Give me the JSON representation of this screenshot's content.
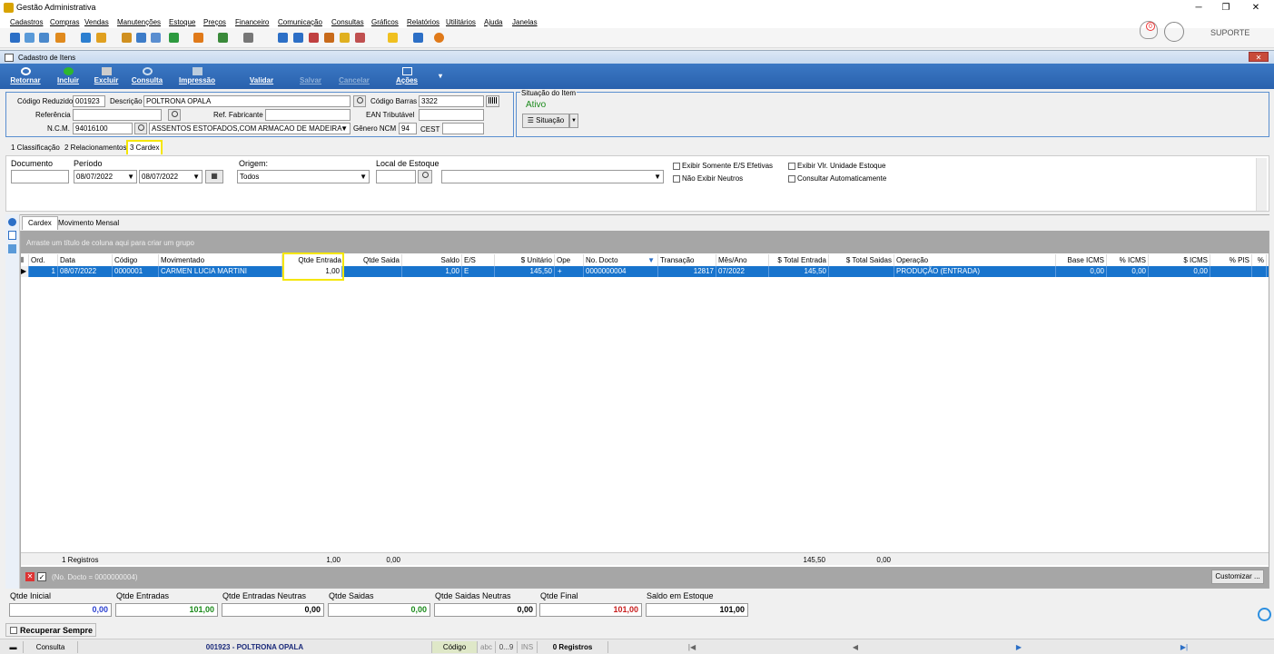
{
  "window": {
    "title": "Gestão Administrativa",
    "minimize": "─",
    "maximize": "❐",
    "close": "✕"
  },
  "menu": [
    "Cadastros",
    "Compras",
    "Vendas",
    "Manutenções",
    "Estoque",
    "Preços",
    "Financeiro",
    "Comunicação",
    "Consultas",
    "Gráficos",
    "Relatórios",
    "Utilitários",
    "Ajuda",
    "Janelas"
  ],
  "user": {
    "notifications": "0",
    "name": "SUPORTE"
  },
  "frame": {
    "title": "Cadastro de Itens",
    "close": "✕"
  },
  "ribbon": {
    "retornar": "Retornar",
    "incluir": "Incluir",
    "excluir": "Excluir",
    "consulta": "Consulta",
    "impressao": "Impressão",
    "validar": "Validar",
    "salvar": "Salvar",
    "cancelar": "Cancelar",
    "acoes": "Ações",
    "acoes_arrow": "▾"
  },
  "item": {
    "codigo_reduzido_label": "Código Reduzido",
    "codigo_reduzido": "001923",
    "descricao_label": "Descrição",
    "descricao": "POLTRONA OPALA",
    "codigo_barras_label": "Código Barras",
    "codigo_barras": "3322",
    "referencia_label": "Referência",
    "referencia": "",
    "ref_fabricante_label": "Ref. Fabricante",
    "ref_fabricante": "",
    "ean_label": "EAN Tributável",
    "ean": "",
    "ncm_label": "N.C.M.",
    "ncm": "94016100",
    "ncm_desc": "ASSENTOS ESTOFADOS,COM ARMACAO DE MADEIRA",
    "genero_label": "Gênero NCM",
    "genero": "94",
    "cest_label": "CEST",
    "cest": ""
  },
  "situacao": {
    "legend": "Situação do Item",
    "status": "Ativo",
    "button": "Situação"
  },
  "tabs": [
    "1 Classificação",
    "2 Relacionamentos",
    "3 Cardex"
  ],
  "filters": {
    "documento_label": "Documento",
    "documento": "",
    "periodo_label": "Período",
    "periodo_ini": "08/07/2022",
    "periodo_fim": "08/07/2022",
    "origem_label": "Origem:",
    "origem": "Todos",
    "local_label": "Local de Estoque",
    "local": "",
    "local_desc": "",
    "chk1": "Exibir Somente E/S Efetivas",
    "chk2": "Não Exibir Neutros",
    "chk3": "Exibir Vlr. Unidade Estoque",
    "chk4": "Consultar Automaticamente"
  },
  "subtabs": [
    "Cardex",
    "Movimento Mensal"
  ],
  "group_hint": "Arraste um título de coluna aqui para criar um grupo",
  "columns": [
    "Ord.",
    "Data",
    "Código",
    "Movimentado",
    "Qtde Entrada",
    "Qtde Saida",
    "Saldo",
    "E/S",
    "$ Unitário",
    "Ope",
    "No. Docto",
    "Transação",
    "Mês/Ano",
    "$ Total Entrada",
    "$ Total Saidas",
    "Operação",
    "Base ICMS",
    "% ICMS",
    "$ ICMS",
    "% PIS",
    "%"
  ],
  "rows": [
    [
      "1",
      "08/07/2022",
      "0000001",
      "CARMEN LUCIA MARTINI",
      "1,00",
      "",
      "1,00",
      "E",
      "145,50",
      "+",
      "0000000004",
      "12817",
      "07/2022",
      "145,50",
      "",
      "PRODUÇÃO (ENTRADA)",
      "0,00",
      "0,00",
      "0,00",
      "",
      ""
    ]
  ],
  "footer": {
    "registros": "1 Registros",
    "qtde_entrada": "1,00",
    "qtde_saida": "0,00",
    "total_entrada": "145,50",
    "total_saidas": "0,00"
  },
  "filter_bar": {
    "text": "(No. Docto = 0000000004)",
    "customizar": "Customizar ..."
  },
  "totals": [
    {
      "label": "Qtde Inicial",
      "value": "0,00",
      "color": "#2a3fd0"
    },
    {
      "label": "Qtde Entradas",
      "value": "101,00",
      "color": "#1a8a1a"
    },
    {
      "label": "Qtde Entradas Neutras",
      "value": "0,00",
      "color": "#000000"
    },
    {
      "label": "Qtde Saidas",
      "value": "0,00",
      "color": "#1a8a1a"
    },
    {
      "label": "Qtde Saidas Neutras",
      "value": "0,00",
      "color": "#000000"
    },
    {
      "label": "Qtde Final",
      "value": "101,00",
      "color": "#c81e1e"
    },
    {
      "label": "Saldo em Estoque",
      "value": "101,00",
      "color": "#000000"
    }
  ],
  "recuperar": "Recuperar Sempre",
  "statusbar": {
    "mode": "Consulta",
    "item": "001923 - POLTRONA OPALA",
    "campo": "Código",
    "abc": "abc",
    "num": "0...9",
    "ins": "INS",
    "registros": "0 Registros",
    "first": "|◀",
    "prev": "◀",
    "next": "▶",
    "last": "▶|"
  }
}
